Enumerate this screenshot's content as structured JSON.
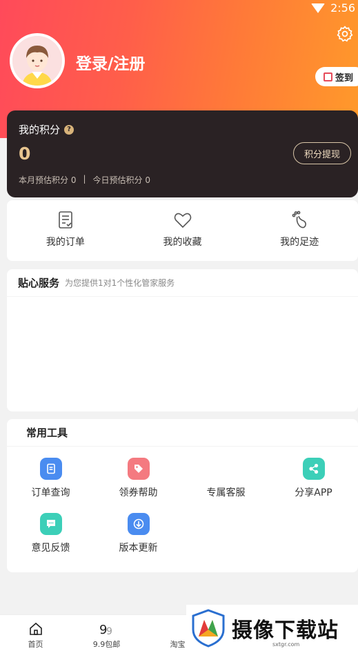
{
  "status": {
    "time": "2:56"
  },
  "profile": {
    "login_label": "登录/注册",
    "signin_label": "签到"
  },
  "points": {
    "title": "我的积分",
    "help_glyph": "?",
    "value": "0",
    "monthly": "本月预估积分 0",
    "separator": "|",
    "today": "今日预估积分 0",
    "withdraw_label": "积分提现"
  },
  "quick_links": [
    {
      "label": "我的订单",
      "icon": "order-list-icon"
    },
    {
      "label": "我的收藏",
      "icon": "heart-icon"
    },
    {
      "label": "我的足迹",
      "icon": "footprint-icon"
    }
  ],
  "service": {
    "title": "贴心服务",
    "subtitle": "为您提供1对1个性化管家服务"
  },
  "tools": {
    "title": "常用工具",
    "items": [
      {
        "label": "订单查询",
        "icon": "document-icon",
        "color": "#4a8cf0"
      },
      {
        "label": "领券帮助",
        "icon": "tag-icon",
        "color": "#f47a80"
      },
      {
        "label": "专属客服",
        "icon": "headset-icon",
        "color": "#ffffff"
      },
      {
        "label": "分享APP",
        "icon": "share-icon",
        "color": "#3ccfb8"
      },
      {
        "label": "意见反馈",
        "icon": "chat-icon",
        "color": "#3ccfb8"
      },
      {
        "label": "版本更新",
        "icon": "download-icon",
        "color": "#4a8cf0"
      }
    ]
  },
  "tabbar": [
    {
      "label": "首页",
      "icon": "home-icon"
    },
    {
      "label": "9.9包邮",
      "icon": "nine-nine-icon"
    },
    {
      "label": "淘宝",
      "icon": "taobao-icon"
    }
  ],
  "watermark": {
    "text": "摄像下载站",
    "url": "sxtgr.com"
  },
  "colors": {
    "accent": "#ff5e4a",
    "card_dark": "#2a2224",
    "gold": "#e8c590"
  }
}
